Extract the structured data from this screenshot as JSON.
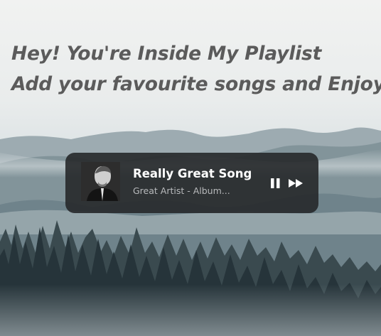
{
  "headline": {
    "line1": "Hey! You're Inside My Playlist",
    "line2": "Add your favourite songs and Enjoy!"
  },
  "player": {
    "song_title": "Really Great Song",
    "artist_album": "Great Artist - Album...",
    "state": "playing",
    "controls": [
      "pause-icon",
      "fast-forward-icon"
    ]
  },
  "colors": {
    "headline_text": "#5b5b5b",
    "player_bg": "#26282a",
    "title_text": "#ffffff",
    "subtitle_text": "#b8babc"
  }
}
